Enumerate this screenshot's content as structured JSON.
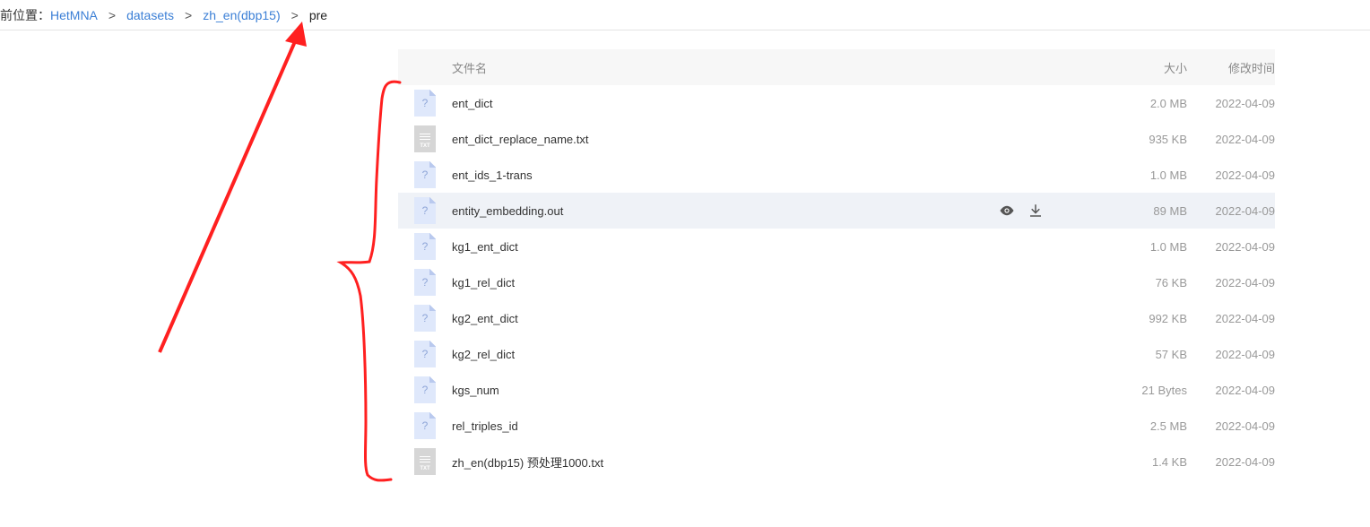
{
  "breadcrumb": {
    "prefix": "当前位置：",
    "crumbs": [
      "HetMNA",
      "datasets",
      "zh_en(dbp15)"
    ],
    "separator": ">",
    "current": "pre"
  },
  "table": {
    "headers": {
      "name": "文件名",
      "size": "大小",
      "modified": "修改时间"
    },
    "rows": [
      {
        "icon": "unknown-file-icon",
        "name": "ent_dict",
        "size": "2.0 MB",
        "modified": "2022-04-09"
      },
      {
        "icon": "txt-file-icon",
        "name": "ent_dict_replace_name.txt",
        "size": "935 KB",
        "modified": "2022-04-09"
      },
      {
        "icon": "unknown-file-icon",
        "name": "ent_ids_1-trans",
        "size": "1.0 MB",
        "modified": "2022-04-09"
      },
      {
        "icon": "unknown-file-icon",
        "name": "entity_embedding.out",
        "size": "89 MB",
        "modified": "2022-04-09"
      },
      {
        "icon": "unknown-file-icon",
        "name": "kg1_ent_dict",
        "size": "1.0 MB",
        "modified": "2022-04-09"
      },
      {
        "icon": "unknown-file-icon",
        "name": "kg1_rel_dict",
        "size": "76 KB",
        "modified": "2022-04-09"
      },
      {
        "icon": "unknown-file-icon",
        "name": "kg2_ent_dict",
        "size": "992 KB",
        "modified": "2022-04-09"
      },
      {
        "icon": "unknown-file-icon",
        "name": "kg2_rel_dict",
        "size": "57 KB",
        "modified": "2022-04-09"
      },
      {
        "icon": "unknown-file-icon",
        "name": "kgs_num",
        "size": "21 Bytes",
        "modified": "2022-04-09"
      },
      {
        "icon": "unknown-file-icon",
        "name": "rel_triples_id",
        "size": "2.5 MB",
        "modified": "2022-04-09"
      },
      {
        "icon": "txt-file-icon",
        "name": "zh_en(dbp15) 预处理1000.txt",
        "size": "1.4 KB",
        "modified": "2022-04-09"
      }
    ],
    "hover_row_actions": [
      "preview-eye-icon",
      "download-icon"
    ]
  },
  "annotation_color": "#ff2020"
}
